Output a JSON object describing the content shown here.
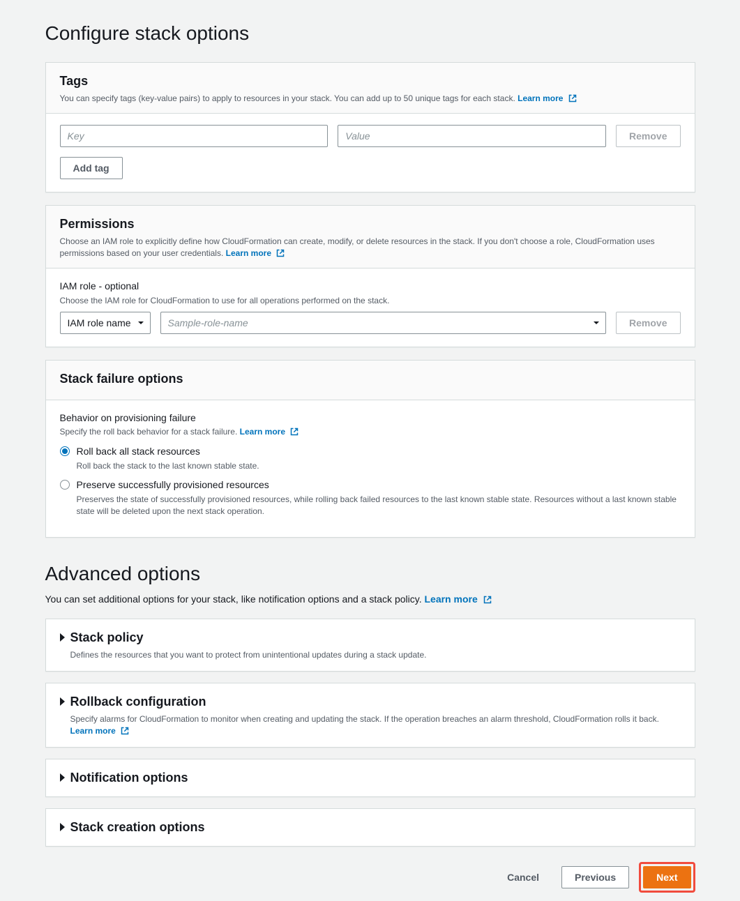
{
  "page_title": "Configure stack options",
  "tags": {
    "title": "Tags",
    "desc": "You can specify tags (key-value pairs) to apply to resources in your stack. You can add up to 50 unique tags for each stack.",
    "learn_more": "Learn more",
    "key_placeholder": "Key",
    "value_placeholder": "Value",
    "remove_label": "Remove",
    "add_tag_label": "Add tag"
  },
  "permissions": {
    "title": "Permissions",
    "desc": "Choose an IAM role to explicitly define how CloudFormation can create, modify, or delete resources in the stack. If you don't choose a role, CloudFormation uses permissions based on your user credentials.",
    "learn_more": "Learn more",
    "field_label": "IAM role - optional",
    "field_help": "Choose the IAM role for CloudFormation to use for all operations performed on the stack.",
    "selector_label": "IAM role name",
    "role_placeholder": "Sample-role-name",
    "remove_label": "Remove"
  },
  "failure": {
    "title": "Stack failure options",
    "behavior_label": "Behavior on provisioning failure",
    "behavior_help": "Specify the roll back behavior for a stack failure.",
    "learn_more": "Learn more",
    "opt1_label": "Roll back all stack resources",
    "opt1_desc": "Roll back the stack to the last known stable state.",
    "opt2_label": "Preserve successfully provisioned resources",
    "opt2_desc": "Preserves the state of successfully provisioned resources, while rolling back failed resources to the last known stable state. Resources without a last known stable state will be deleted upon the next stack operation."
  },
  "advanced": {
    "heading": "Advanced options",
    "sub": "You can set additional options for your stack, like notification options and a stack policy.",
    "learn_more": "Learn more",
    "stack_policy": {
      "title": "Stack policy",
      "desc": "Defines the resources that you want to protect from unintentional updates during a stack update."
    },
    "rollback": {
      "title": "Rollback configuration",
      "desc": "Specify alarms for CloudFormation to monitor when creating and updating the stack. If the operation breaches an alarm threshold, CloudFormation rolls it back.",
      "learn_more": "Learn more"
    },
    "notification": {
      "title": "Notification options"
    },
    "creation": {
      "title": "Stack creation options"
    }
  },
  "footer": {
    "cancel": "Cancel",
    "previous": "Previous",
    "next": "Next"
  }
}
